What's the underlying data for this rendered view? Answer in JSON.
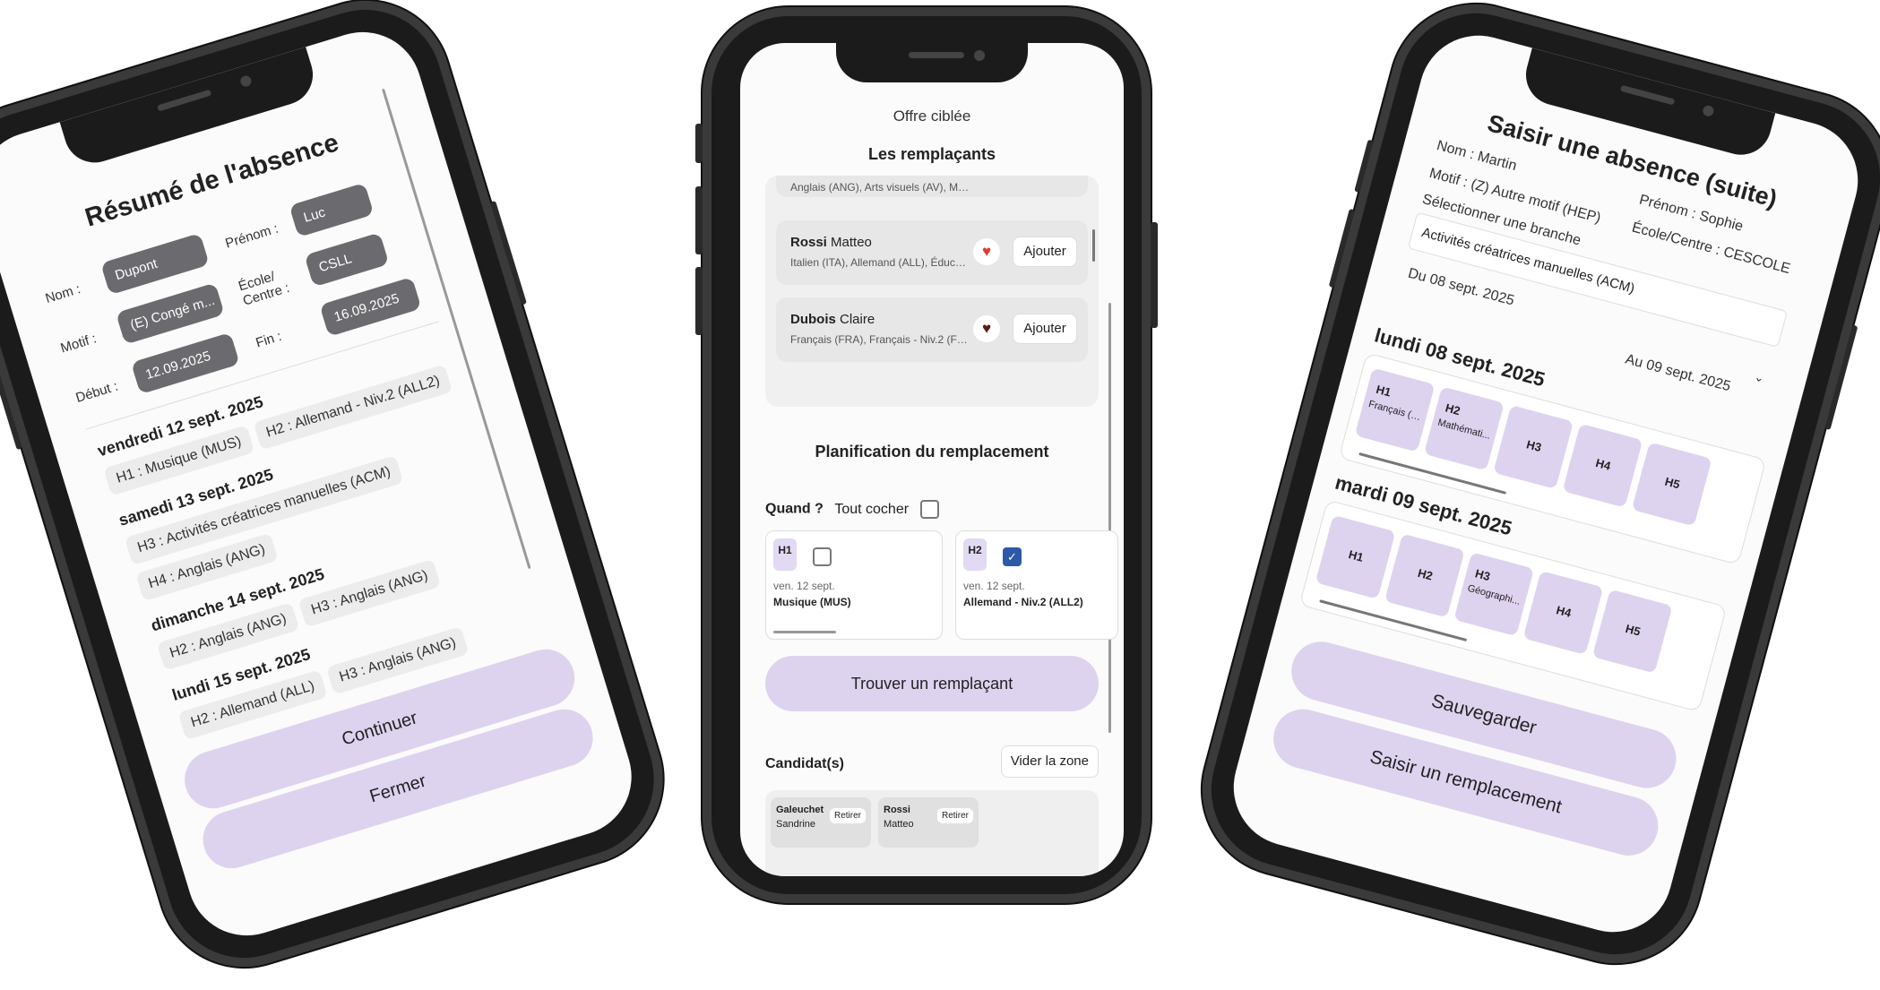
{
  "phone1": {
    "title": "Résumé de l'absence",
    "fields": {
      "nom_label": "Nom :",
      "nom_value": "Dupont",
      "prenom_label": "Prénom :",
      "prenom_value": "Luc",
      "motif_label": "Motif :",
      "motif_value": "(E) Congé m...",
      "ecole_label": "École/ Centre :",
      "ecole_value": "CSLL",
      "debut_label": "Début :",
      "debut_value": "12.09.2025",
      "fin_label": "Fin :",
      "fin_value": "16.09.2025"
    },
    "days": [
      {
        "date": "vendredi 12 sept. 2025",
        "items": [
          "H1 : Musique (MUS)",
          "H2 : Allemand - Niv.2 (ALL2)"
        ]
      },
      {
        "date": "samedi 13 sept. 2025",
        "items": [
          "H3 : Activités créatrices manuelles (ACM)",
          "H4 : Anglais (ANG)"
        ]
      },
      {
        "date": "dimanche 14 sept. 2025",
        "items": [
          "H2 : Anglais (ANG)",
          "H3 : Anglais (ANG)"
        ]
      },
      {
        "date": "lundi 15 sept. 2025",
        "items": [
          "H2 : Allemand (ALL)",
          "H3 : Anglais (ANG)"
        ]
      }
    ],
    "continue_label": "Continuer",
    "close_label": "Fermer"
  },
  "phone2": {
    "header": "Offre ciblée",
    "replacements_title": "Les remplaçants",
    "partial_row": "Anglais (ANG), Arts visuels (AV), Mu...",
    "replacements": [
      {
        "last": "Rossi",
        "first": "Matteo",
        "subjects": "Italien (ITA), Allemand (ALL), Éducati...",
        "add_label": "Ajouter"
      },
      {
        "last": "Dubois",
        "first": "Claire",
        "subjects": "Français (FRA), Français - Niv.2 (FRA...",
        "add_label": "Ajouter"
      }
    ],
    "planning_title": "Planification du remplacement",
    "when_label": "Quand ?",
    "check_all_label": "Tout cocher",
    "slots": [
      {
        "tag": "H1",
        "date": "ven. 12 sept.",
        "subject": "Musique (MUS)",
        "checked": false
      },
      {
        "tag": "H2",
        "date": "ven. 12 sept.",
        "subject": "Allemand - Niv.2 (ALL2)",
        "checked": true
      }
    ],
    "find_label": "Trouver un remplaçant",
    "candidates_label": "Candidat(s)",
    "clear_label": "Vider la zone",
    "candidates": [
      {
        "last": "Galeuchet",
        "first": "Sandrine",
        "remove_label": "Retirer"
      },
      {
        "last": "Rossi",
        "first": "Matteo",
        "remove_label": "Retirer"
      }
    ]
  },
  "phone3": {
    "title": "Saisir une absence (suite)",
    "nom": "Nom : Martin",
    "prenom": "Prénom : Sophie",
    "motif": "Motif : (Z) Autre motif (HEP)",
    "ecole": "École/Centre : CESCOLE",
    "branch_label": "Sélectionner une branche",
    "branch_value": "Activités créatrices manuelles (ACM)",
    "from_date": "Du 08 sept. 2025",
    "to_date": "Au 09 sept. 2025",
    "days": [
      {
        "date": "lundi 08 sept. 2025",
        "hours": [
          {
            "h": "H1",
            "sub": "Français (F..."
          },
          {
            "h": "H2",
            "sub": "Mathémati..."
          },
          {
            "h": "H3",
            "sub": ""
          },
          {
            "h": "H4",
            "sub": ""
          },
          {
            "h": "H5",
            "sub": ""
          }
        ]
      },
      {
        "date": "mardi 09 sept. 2025",
        "hours": [
          {
            "h": "H1",
            "sub": ""
          },
          {
            "h": "H2",
            "sub": ""
          },
          {
            "h": "H3",
            "sub": "Géographi..."
          },
          {
            "h": "H4",
            "sub": ""
          },
          {
            "h": "H5",
            "sub": ""
          }
        ]
      }
    ],
    "save_label": "Sauvegarder",
    "replace_label": "Saisir un remplacement"
  }
}
